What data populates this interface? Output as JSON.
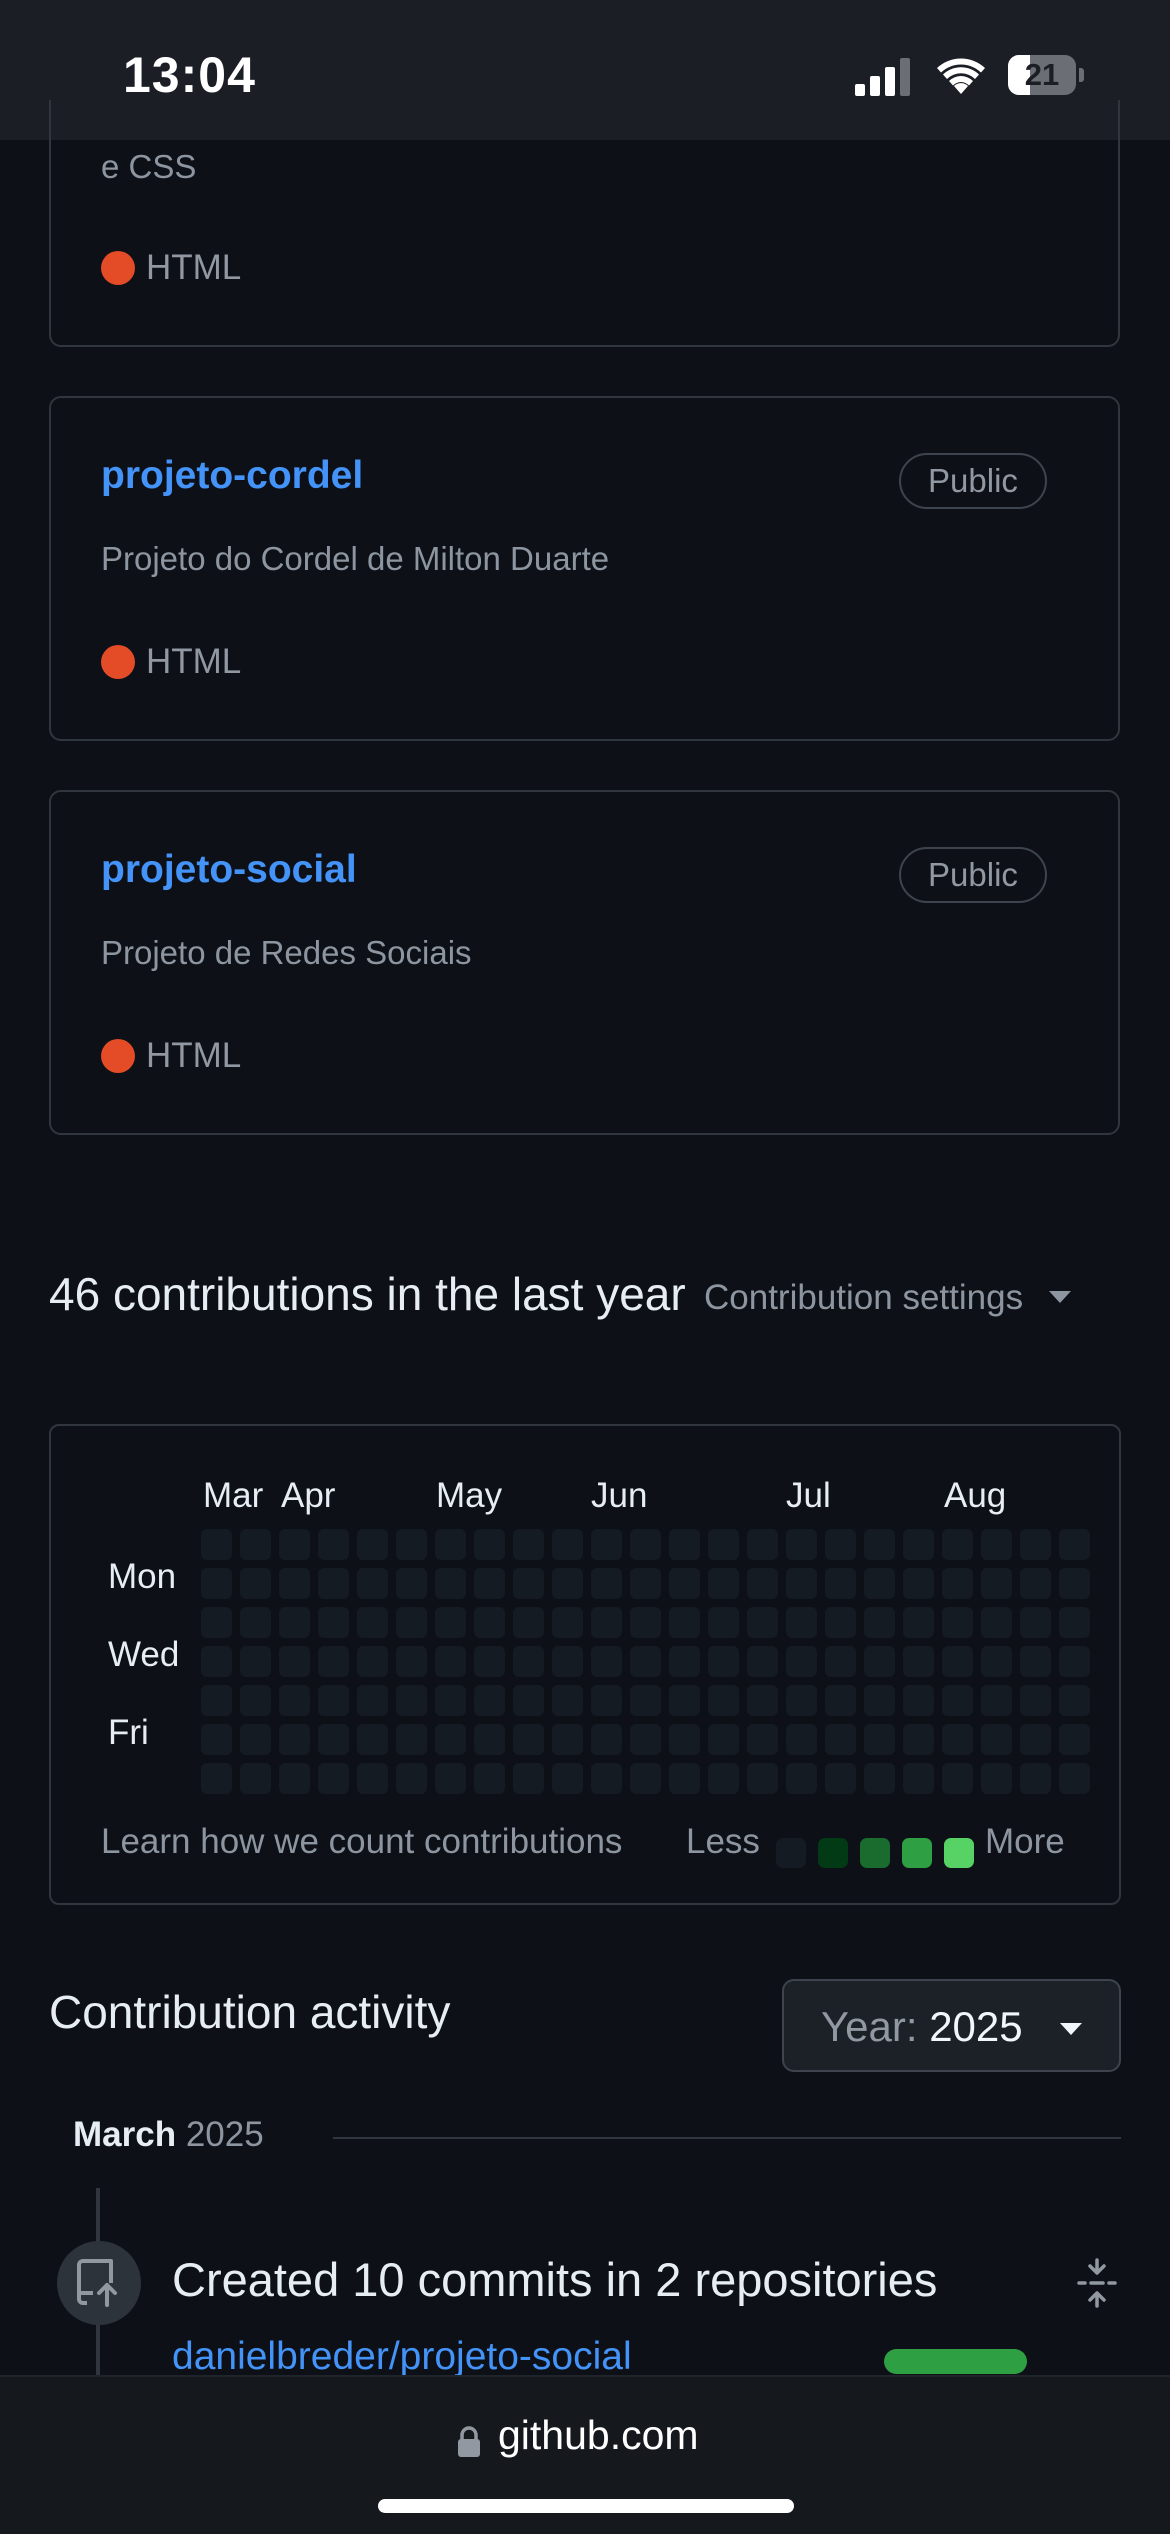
{
  "status_bar": {
    "time": "13:04",
    "battery": "21"
  },
  "top_card": {
    "description_tail": "e CSS",
    "language": "HTML"
  },
  "repos": [
    {
      "name": "projeto-cordel",
      "visibility": "Public",
      "description": "Projeto do Cordel de Milton Duarte",
      "language": "HTML"
    },
    {
      "name": "projeto-social",
      "visibility": "Public",
      "description": "Projeto de Redes Sociais",
      "language": "HTML"
    }
  ],
  "contributions": {
    "title": "46 contributions in the last year",
    "settings_label": "Contribution settings",
    "months": [
      "Mar",
      "Apr",
      "May",
      "Jun",
      "Jul",
      "Aug"
    ],
    "days": [
      "Mon",
      "Wed",
      "Fri"
    ],
    "learn_label": "Learn how we count contributions",
    "less_label": "Less",
    "more_label": "More",
    "level_colors": [
      "#151b23",
      "#033a16",
      "#196c2e",
      "#2ea043",
      "#56d364"
    ]
  },
  "activity": {
    "title": "Contribution activity",
    "year_prefix": "Year:",
    "year_value": "2025",
    "month": "March",
    "year": "2025",
    "event_title": "Created 10 commits in 2 repositories",
    "event_repo": "danielbreder/projeto-social"
  },
  "browser": {
    "url": "github.com"
  }
}
